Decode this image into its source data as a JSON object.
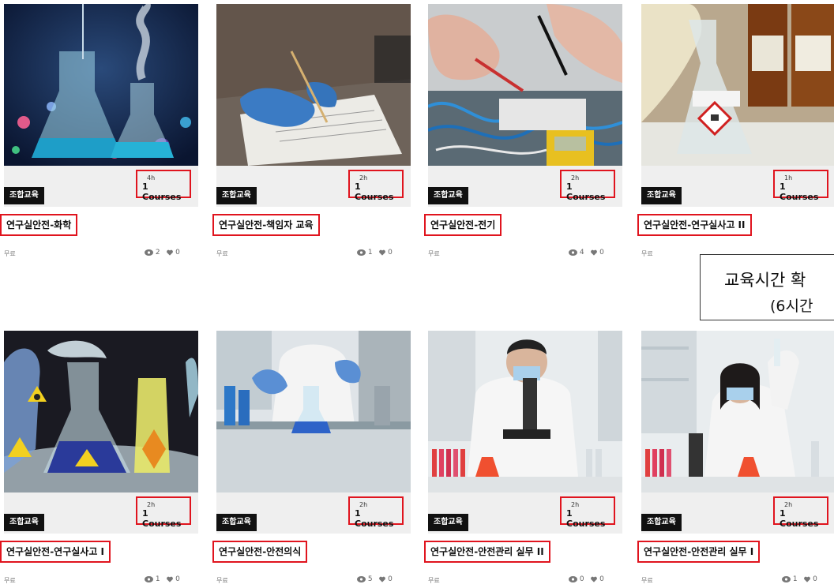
{
  "cards": [
    {
      "badge": "조합교육",
      "hours": "4h",
      "courses": "1 Courses",
      "title": "연구실안전-화학",
      "price": "무료",
      "views": "2",
      "likes": "0"
    },
    {
      "badge": "조합교육",
      "hours": "2h",
      "courses": "1 Courses",
      "title": "연구실안전-책임자 교육",
      "price": "무료",
      "views": "1",
      "likes": "0"
    },
    {
      "badge": "조합교육",
      "hours": "2h",
      "courses": "1 Courses",
      "title": "연구실안전-전기",
      "price": "무료",
      "views": "4",
      "likes": "0"
    },
    {
      "badge": "조합교육",
      "hours": "1h",
      "courses": "1 Courses",
      "title": "연구실안전-연구실사고 II",
      "price": "무료",
      "views": "",
      "likes": ""
    },
    {
      "badge": "조합교육",
      "hours": "2h",
      "courses": "1 Courses",
      "title": "연구실안전-연구실사고 I",
      "price": "무료",
      "views": "1",
      "likes": "0"
    },
    {
      "badge": "조합교육",
      "hours": "2h",
      "courses": "1 Courses",
      "title": "연구실안전-안전의식",
      "price": "무료",
      "views": "5",
      "likes": "0"
    },
    {
      "badge": "조합교육",
      "hours": "2h",
      "courses": "1 Courses",
      "title": "연구실안전-안전관리 실무 II",
      "price": "무료",
      "views": "0",
      "likes": "0"
    },
    {
      "badge": "조합교육",
      "hours": "2h",
      "courses": "1 Courses",
      "title": "연구실안전-안전관리 실무 I",
      "price": "무료",
      "views": "1",
      "likes": "0"
    }
  ],
  "notice": {
    "line1": "교육시간 확",
    "line2": "(6시간"
  },
  "icons": {
    "views": "eye-icon",
    "likes": "heart-icon"
  },
  "colors": {
    "highlight": "#e0141e",
    "badge_bg": "#111111",
    "meta_bg": "#efefef"
  }
}
